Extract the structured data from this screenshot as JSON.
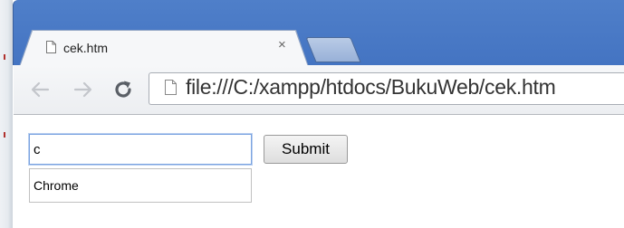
{
  "browser": {
    "tab": {
      "title": "cek.htm",
      "close_glyph": "×",
      "icon": "page-icon"
    },
    "new_tab_icon": "new-tab-icon",
    "toolbar": {
      "back_icon": "back-arrow-icon",
      "forward_icon": "forward-arrow-icon",
      "reload_icon": "reload-icon",
      "url": "file:///C:/xampp/htdocs/BukuWeb/cek.htm"
    },
    "colors": {
      "titlebar": "#4a7ac6",
      "tab_bg": "#f6f7f9",
      "focus_border": "#7aa3e0"
    }
  },
  "page": {
    "input": {
      "value": "c"
    },
    "autocomplete": [
      "Chrome"
    ],
    "submit_label": "Submit"
  }
}
